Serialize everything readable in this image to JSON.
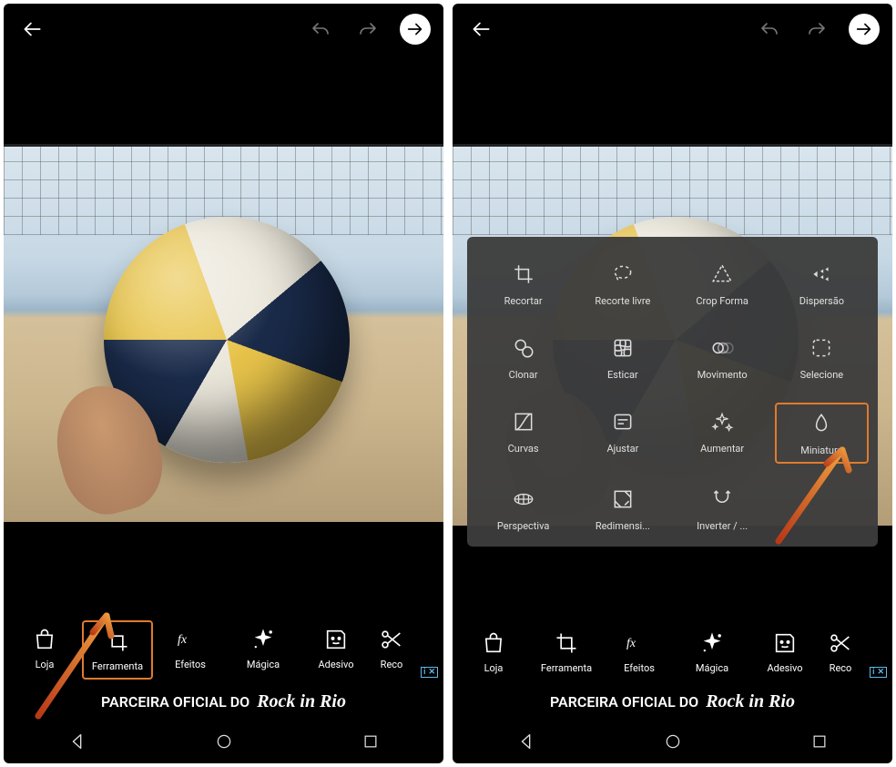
{
  "left": {
    "bottombar": [
      {
        "key": "loja",
        "label": "Loja"
      },
      {
        "key": "ferramenta",
        "label": "Ferramenta",
        "highlight": true
      },
      {
        "key": "efeitos",
        "label": "Efeitos"
      },
      {
        "key": "magica",
        "label": "Mágica"
      },
      {
        "key": "adesivo",
        "label": "Adesivo"
      },
      {
        "key": "recortar",
        "label": "Reco"
      }
    ],
    "ad_text": "PARCEIRA OFICIAL DO",
    "ad_brand": "Rock in Rio"
  },
  "right": {
    "bottombar": [
      {
        "key": "loja",
        "label": "Loja"
      },
      {
        "key": "ferramenta",
        "label": "Ferramenta"
      },
      {
        "key": "efeitos",
        "label": "Efeitos"
      },
      {
        "key": "magica",
        "label": "Mágica"
      },
      {
        "key": "adesivo",
        "label": "Adesivo"
      },
      {
        "key": "recortar",
        "label": "Reco"
      }
    ],
    "tools_panel": [
      {
        "key": "recortar",
        "label": "Recortar"
      },
      {
        "key": "recorte-livre",
        "label": "Recorte livre"
      },
      {
        "key": "crop-forma",
        "label": "Crop Forma"
      },
      {
        "key": "dispersao",
        "label": "Dispersão"
      },
      {
        "key": "clonar",
        "label": "Clonar"
      },
      {
        "key": "esticar",
        "label": "Esticar"
      },
      {
        "key": "movimento",
        "label": "Movimento"
      },
      {
        "key": "selecione",
        "label": "Selecione"
      },
      {
        "key": "curvas",
        "label": "Curvas"
      },
      {
        "key": "ajustar",
        "label": "Ajustar"
      },
      {
        "key": "aumentar",
        "label": "Aumentar"
      },
      {
        "key": "miniatura",
        "label": "Miniatura",
        "highlight": true
      },
      {
        "key": "perspectiva",
        "label": "Perspectiva"
      },
      {
        "key": "redimensionar",
        "label": "Redimensi..."
      },
      {
        "key": "inverter",
        "label": "Inverter / ..."
      }
    ],
    "ad_text": "PARCEIRA OFICIAL DO",
    "ad_brand": "Rock in Rio"
  },
  "ad_info_icon": "i",
  "ad_close_icon": "✕"
}
